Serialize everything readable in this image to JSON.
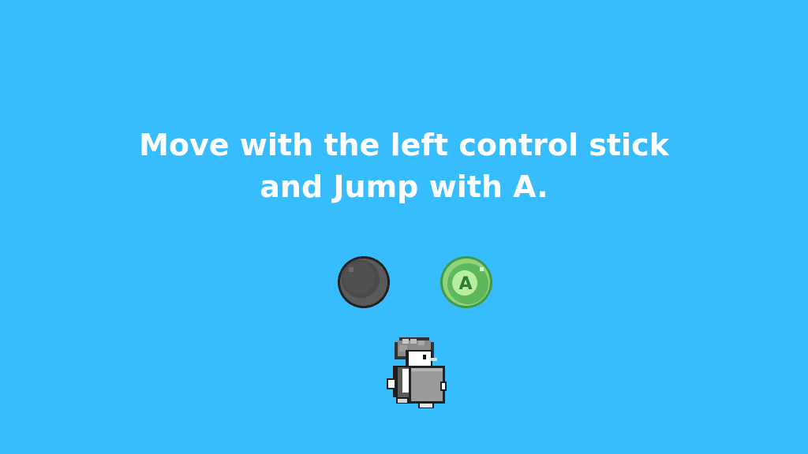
{
  "tutorial": {
    "line1": "Move with the left control stick",
    "line2": "and Jump with A."
  },
  "controls": {
    "stick_icon": "left-control-stick-icon",
    "a_button_label": "A"
  },
  "character": {
    "icon": "knight-penguin-sprite"
  },
  "colors": {
    "background": "#37bcfe",
    "text": "#ffffff",
    "stick": "#565656",
    "a_button": "#4caf50"
  }
}
